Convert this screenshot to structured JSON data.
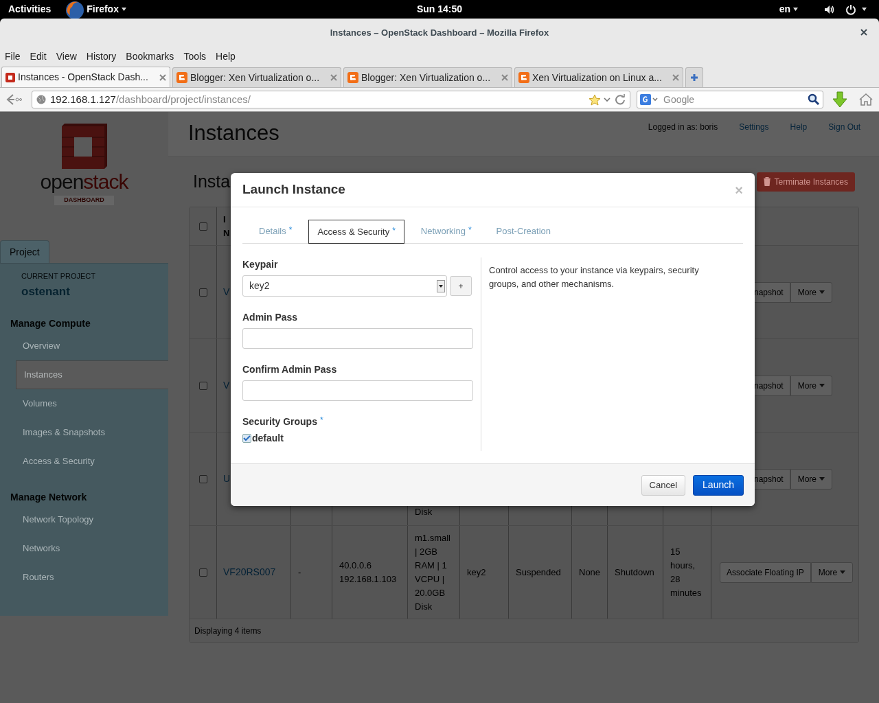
{
  "top_bar": {
    "activities": "Activities",
    "app_menu": "Firefox",
    "clock": "Sun 14:50",
    "language": "en"
  },
  "window": {
    "title": "Instances – OpenStack Dashboard – Mozilla Firefox"
  },
  "menu_bar": [
    "File",
    "Edit",
    "View",
    "History",
    "Bookmarks",
    "Tools",
    "Help"
  ],
  "browser_tabs": [
    {
      "label": "Instances - OpenStack Dash...",
      "selected": true,
      "kind": "openstack"
    },
    {
      "label": "Blogger: Xen Virtualization o...",
      "selected": false,
      "kind": "blogger"
    },
    {
      "label": "Blogger: Xen Virtualization o...",
      "selected": false,
      "kind": "blogger"
    },
    {
      "label": "Xen Virtualization on Linux a...",
      "selected": false,
      "kind": "blogger"
    }
  ],
  "address_bar": {
    "host": "192.168.1.127",
    "path": "/dashboard/project/instances/"
  },
  "search_bar": {
    "placeholder": "Google"
  },
  "sidebar": {
    "logo_left": "open",
    "logo_right": "stack",
    "logo_subtitle": "DASHBOARD",
    "tab": "Project",
    "current_project_label": "CURRENT PROJECT",
    "current_project": "ostenant",
    "sections": [
      {
        "heading": "Manage Compute",
        "items": [
          {
            "label": "Overview",
            "selected": false
          },
          {
            "label": "Instances",
            "selected": true
          },
          {
            "label": "Volumes",
            "selected": false
          },
          {
            "label": "Images & Snapshots",
            "selected": false
          },
          {
            "label": "Access & Security",
            "selected": false
          }
        ]
      },
      {
        "heading": "Manage Network",
        "items": [
          {
            "label": "Network Topology",
            "selected": false
          },
          {
            "label": "Networks",
            "selected": false
          },
          {
            "label": "Routers",
            "selected": false
          }
        ]
      }
    ]
  },
  "header": {
    "title": "Instances",
    "logged_in": "Logged in as: boris",
    "links": [
      "Settings",
      "Help",
      "Sign Out"
    ]
  },
  "panel": {
    "title": "Insta",
    "terminate_button": "Terminate Instances",
    "table": {
      "select_all_checked": false,
      "column_2": "I\nN",
      "rows": [
        {
          "kind": "partial",
          "checked": false,
          "name": "V",
          "cells": {},
          "actions": [
            "napshot",
            "More"
          ]
        },
        {
          "kind": "partial",
          "checked": false,
          "name": "V",
          "cells": {},
          "actions": [
            "napshot",
            "More"
          ]
        },
        {
          "kind": "partial",
          "checked": false,
          "name": "U",
          "cells": {
            "column_5": "Disk"
          },
          "actions": [
            "napshot",
            "More"
          ]
        },
        {
          "kind": "full",
          "checked": false,
          "name": "VF20RS007",
          "cells": {
            "column_3": "-",
            "column_4": "40.0.0.6 192.168.1.103",
            "column_5": "m1.small | 2GB RAM | 1 VCPU | 20.0GB Disk",
            "column_6": "key2",
            "column_7": "Suspended",
            "column_8": "None",
            "column_9": "Shutdown",
            "column_10": "15 hours, 28 minutes"
          },
          "actions": [
            "Associate Floating IP",
            "More"
          ]
        }
      ],
      "footer": "Displaying 4 items"
    }
  },
  "modal": {
    "title": "Launch Instance",
    "close": "×",
    "tabs": [
      {
        "label": "Details",
        "required_mark": "*",
        "selected": false
      },
      {
        "label": "Access & Security",
        "required_mark": "*",
        "selected": true
      },
      {
        "label": "Networking",
        "required_mark": "*",
        "selected": false
      },
      {
        "label": "Post-Creation",
        "selected": false
      }
    ],
    "fields": [
      {
        "kind": "select",
        "label": "Keypair",
        "value": "key2",
        "add_button": "+"
      },
      {
        "kind": "password",
        "label": "Admin Pass"
      },
      {
        "kind": "password",
        "label": "Confirm Admin Pass"
      },
      {
        "kind": "checkboxes",
        "label": "Security Groups",
        "required_mark": "*",
        "options": [
          {
            "label": "default",
            "checked": true
          }
        ]
      }
    ],
    "help_text": "Control access to your instance via keypairs, security groups, and other mechanisms.",
    "buttons": [
      {
        "label": "Cancel",
        "kind": "secondary"
      },
      {
        "label": "Launch",
        "kind": "primary"
      }
    ]
  }
}
